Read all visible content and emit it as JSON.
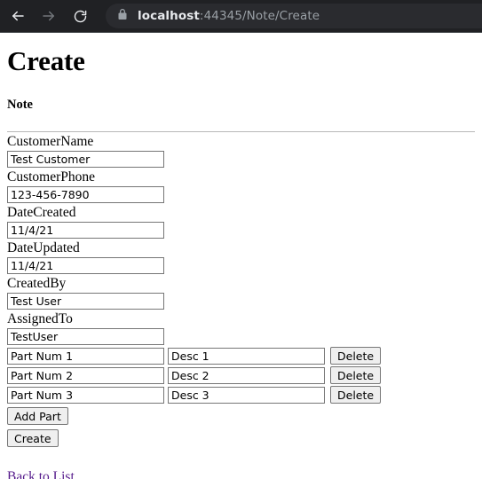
{
  "browser": {
    "back_icon": "back-arrow-icon",
    "forward_icon": "forward-arrow-icon",
    "reload_icon": "reload-icon",
    "lock_icon": "lock-icon",
    "url_host": "localhost",
    "url_path": ":44345/Note/Create",
    "toolbar_bg": "#202124",
    "urlbar_bg": "#2a2b2f",
    "host_color": "#e8eaed",
    "path_color": "#9aa0a6"
  },
  "page": {
    "title": "Create",
    "section": "Note",
    "link_color": "#551a8b",
    "fields": [
      {
        "label": "CustomerName",
        "value": "Test Customer"
      },
      {
        "label": "CustomerPhone",
        "value": "123-456-7890"
      },
      {
        "label": "DateCreated",
        "value": "11/4/21"
      },
      {
        "label": "DateUpdated",
        "value": "11/4/21"
      },
      {
        "label": "CreatedBy",
        "value": "Test User"
      },
      {
        "label": "AssignedTo",
        "value": "TestUser"
      }
    ],
    "parts": [
      {
        "part_number": "Part Num 1",
        "description": "Desc 1",
        "delete_label": "Delete"
      },
      {
        "part_number": "Part Num 2",
        "description": "Desc 2",
        "delete_label": "Delete"
      },
      {
        "part_number": "Part Num 3",
        "description": "Desc 3",
        "delete_label": "Delete"
      }
    ],
    "add_part_label": "Add Part",
    "create_label": "Create",
    "back_link_label": "Back to List"
  }
}
